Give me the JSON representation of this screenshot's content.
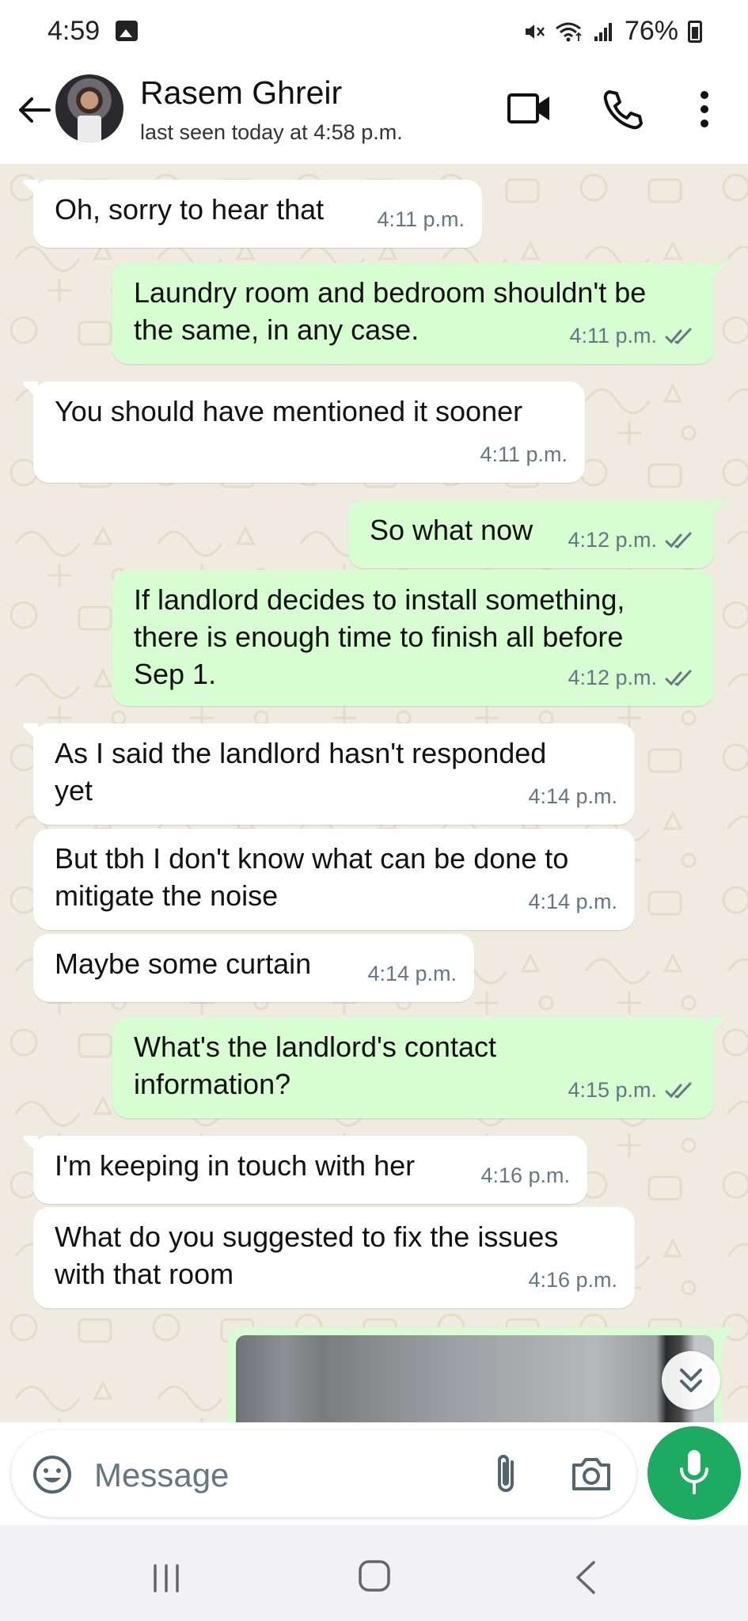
{
  "status_bar": {
    "time": "4:59",
    "battery": "76%",
    "icons": [
      "gallery-icon",
      "muted-icon",
      "wifi-icon",
      "signal-icon",
      "battery-icon"
    ]
  },
  "header": {
    "contact_name": "Rasem Ghreir",
    "last_seen": "last seen today at 4:58 p.m.",
    "icons": [
      "back-arrow-icon",
      "avatar",
      "video-call-icon",
      "voice-call-icon",
      "more-options-icon"
    ]
  },
  "messages": [
    {
      "direction": "in",
      "text": "Oh, sorry to hear that",
      "time": "4:11 p.m."
    },
    {
      "direction": "out",
      "text": "Laundry room and bedroom shouldn't be\nthe same, in any case.",
      "time": "4:11 p.m.",
      "read": true
    },
    {
      "direction": "in",
      "text": "You should have mentioned it sooner",
      "time": "4:11 p.m."
    },
    {
      "direction": "out",
      "text": "So what now",
      "time": "4:12 p.m.",
      "read": true
    },
    {
      "direction": "out",
      "text": "If landlord decides to install something,\nthere is enough time to finish all before\nSep 1.",
      "time": "4:12 p.m.",
      "read": true
    },
    {
      "direction": "in",
      "text": "As I said the landlord hasn't responded\nyet",
      "time": "4:14 p.m."
    },
    {
      "direction": "in",
      "text": "But tbh I don't know what can be done to\nmitigate the noise",
      "time": "4:14 p.m."
    },
    {
      "direction": "in",
      "text": "Maybe some curtain",
      "time": "4:14 p.m."
    },
    {
      "direction": "out",
      "text": "What's the landlord's contact\ninformation?",
      "time": "4:15 p.m.",
      "read": true
    },
    {
      "direction": "in",
      "text": "I'm keeping in touch with her",
      "time": "4:16 p.m."
    },
    {
      "direction": "in",
      "text": "What do you suggested to fix the issues\nwith that room",
      "time": "4:16 p.m."
    }
  ],
  "composer": {
    "placeholder": "Message",
    "icons": [
      "emoji-icon",
      "attach-icon",
      "camera-icon",
      "mic-icon"
    ]
  },
  "colors": {
    "incoming_bubble": "#ffffff",
    "outgoing_bubble": "#d9fdd3",
    "chat_background": "#f0ebe1",
    "accent_green": "#1daa61",
    "read_ticks": "#667781",
    "meta_text": "#667781"
  },
  "nav": {
    "icons": [
      "recents-icon",
      "home-icon",
      "back-icon"
    ]
  }
}
